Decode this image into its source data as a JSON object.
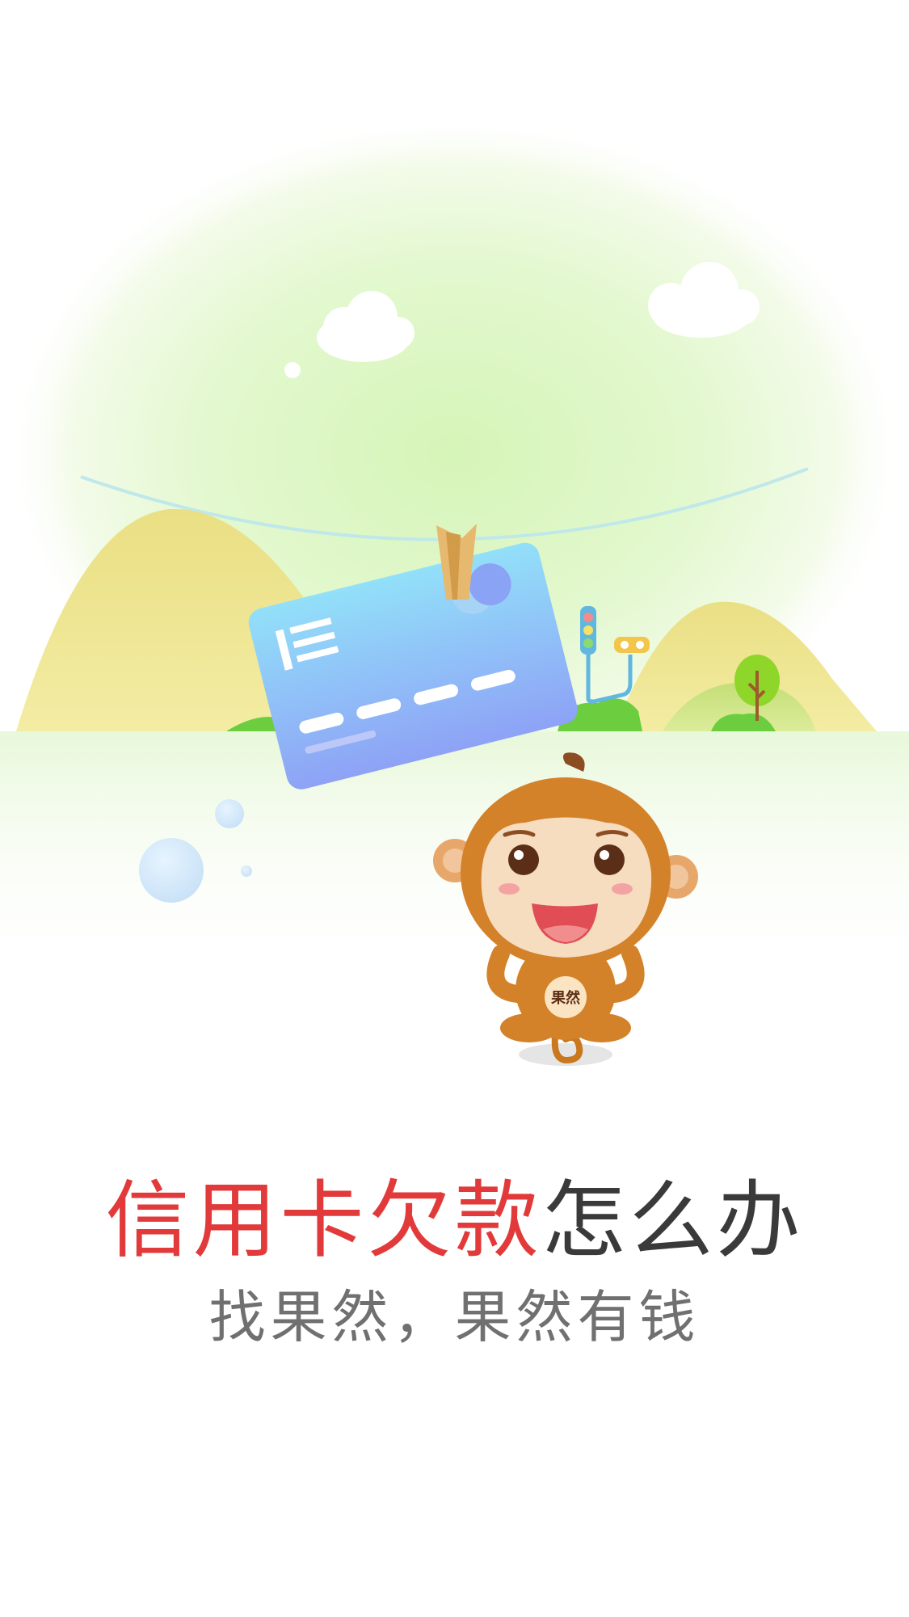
{
  "splash": {
    "headline_highlight": "信用卡欠款",
    "headline_rest": "怎么办",
    "subtitle": "找果然，果然有钱",
    "mascot_badge": "果然"
  },
  "colors": {
    "highlight": "#e23a3a",
    "headline": "#3a3a3a",
    "subtitle": "#707070",
    "monkey": "#d4822a",
    "card": "#8fb7f7"
  }
}
